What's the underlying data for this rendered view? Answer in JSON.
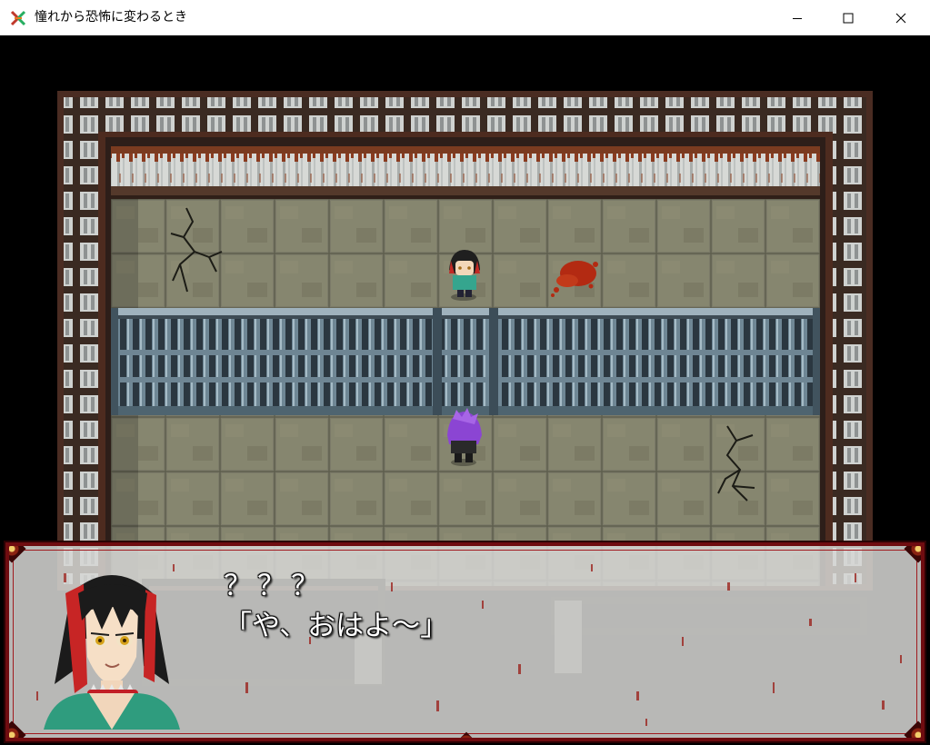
{
  "window": {
    "title": "憧れから恐怖に変わるとき",
    "icons": [
      "app-icon",
      "minimize-icon",
      "maximize-icon",
      "close-icon"
    ]
  },
  "scene": {
    "type": "jail-room",
    "npc_top": "red-black-haired-character-sprite",
    "player": "purple-haired-character-sprite",
    "decor": [
      "floor-crack",
      "blood-splatter",
      "iron-bars"
    ]
  },
  "message": {
    "speaker": "？？？",
    "text": "「や、おはよ～」",
    "portrait": "character-portrait-red-black-hair-spiked-collar"
  },
  "colors": {
    "floor": "#7b7b68",
    "wall_frame": "#5a3a2c",
    "bars": "#5a7485",
    "blood": "#b32a12",
    "message_border": "#6f0c10"
  }
}
